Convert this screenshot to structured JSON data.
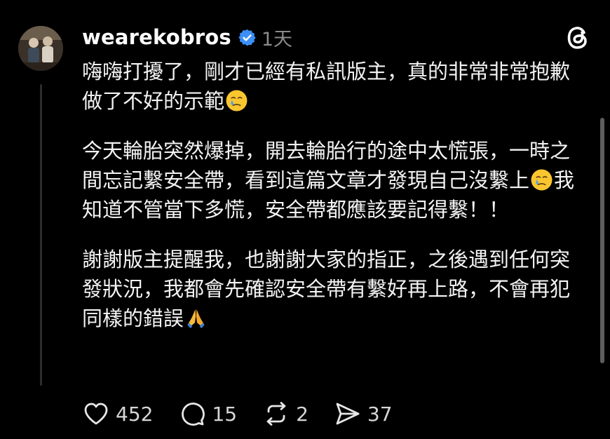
{
  "post": {
    "username": "wearekobros",
    "timestamp": "1天",
    "paragraphs": [
      {
        "text": "嗨嗨打擾了，剛才已經有私訊版主，真的非常非常抱歉做了不好的示範",
        "emoji": "crying-face"
      },
      {
        "text_before": "今天輪胎突然爆掉，開去輪胎行的途中太慌張，一時之間忘記繫安全帶，看到這篇文章才發現自己沒繫上",
        "emoji": "crying-face",
        "text_after": "我知道不管當下多慌，安全帶都應該要記得繫！！"
      },
      {
        "text": "謝謝版主提醒我，也謝謝大家的指正，之後遇到任何突發狀況，我都會先確認安全帶有繫好再上路，不會再犯同樣的錯誤",
        "emoji": "folded-hands"
      }
    ]
  },
  "actions": {
    "likes": "452",
    "replies": "15",
    "reposts": "2",
    "shares": "37"
  },
  "icons": {
    "verified": "verified-badge-icon",
    "app": "threads-logo-icon",
    "like": "heart-icon",
    "reply": "comment-bubble-icon",
    "repost": "repost-icon",
    "share": "send-icon"
  },
  "colors": {
    "background": "#000000",
    "text": "#f3f3f3",
    "muted": "#8b8b8b",
    "verified": "#3b8ff7"
  }
}
